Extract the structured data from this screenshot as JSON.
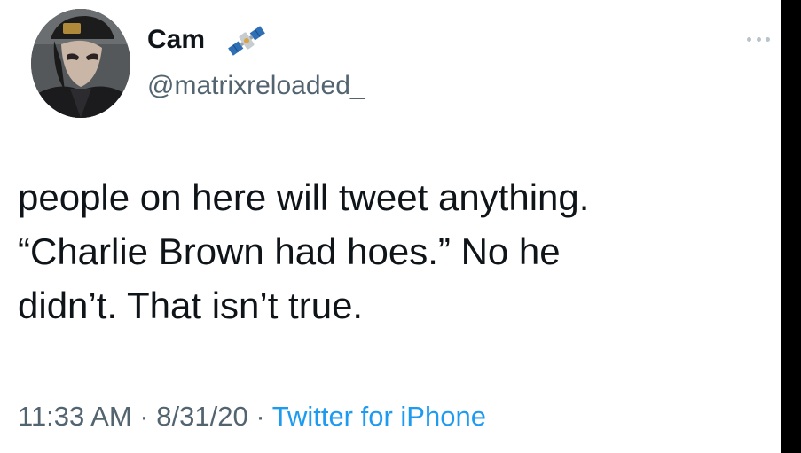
{
  "tweet": {
    "author": {
      "display_name": "Cam",
      "handle": "@matrixreloaded_",
      "name_emoji": "satellite-emoji",
      "avatar": "profile-photo"
    },
    "more_icon": "more-dots-icon",
    "text": "people on here will tweet anything.\n“Charlie Brown had hoes.” No he\ndidn’t. That isn’t true.",
    "time": "11:33 AM",
    "date": "8/31/20",
    "separator": "·",
    "source": "Twitter for iPhone"
  },
  "colors": {
    "text": "#0f1419",
    "secondary": "#536471",
    "link": "#1d9bf0",
    "background": "#ffffff"
  }
}
